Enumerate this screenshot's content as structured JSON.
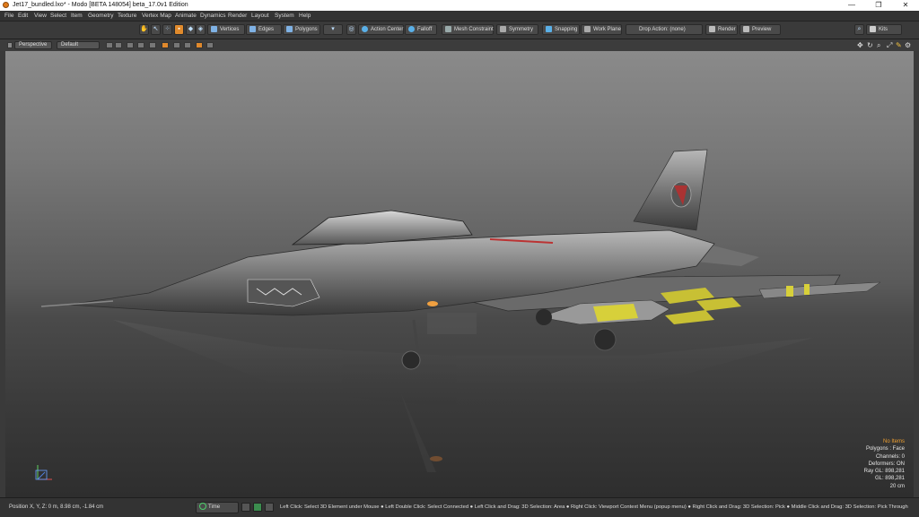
{
  "window": {
    "title": "Jet17_bundled.lxo* - Modo [BETA 148054]  beta_17.0v1 Edition",
    "minimize": "—",
    "restore": "❐",
    "close": "✕"
  },
  "menu": [
    "File",
    "Edit",
    "View",
    "Select",
    "Item",
    "Geometry",
    "Texture",
    "Vertex Map",
    "Animate",
    "Dynamics",
    "Render",
    "Layout",
    "System",
    "Help"
  ],
  "toolbar": {
    "vertices": "Vertices",
    "edges": "Edges",
    "polygons": "Polygons",
    "action_center": "Action Center",
    "falloff": "Falloff",
    "mesh_constraint": "Mesh Constraint",
    "symmetry": "Symmetry",
    "snapping": "Snapping",
    "work_plane": "Work Plane",
    "drop_action": "Drop Action: (none)",
    "render": "Render",
    "preview": "Preview",
    "kits": "Kits"
  },
  "viewport": {
    "view": "Perspective",
    "shading": "Default",
    "stats": {
      "items": "No Items",
      "polygons": "Polygons : Face",
      "channels": "Channels: 0",
      "deformers": "Deformers: ON",
      "ray_gl": "Ray GL: 898,281",
      "gl": "GL: 898,281",
      "scale": "20 cm"
    }
  },
  "status": {
    "position": "Position X, Y, Z:   0 m, 8.98 cm, -1.84 cm",
    "time": "Time",
    "hint": "Left Click: Select 3D Element under Mouse ● Left Double Click: Select Connected ● Left Click and Drag: 3D Selection: Area ● Right Click: Viewport Context Menu (popup menu) ● Right Click and Drag: 3D Selection: Pick ● Middle Click and Drag: 3D Selection: Pick Through"
  },
  "colors": {
    "accent": "#e0892c",
    "ui_dark": "#333333",
    "stats_highlight": "#f0a030"
  }
}
